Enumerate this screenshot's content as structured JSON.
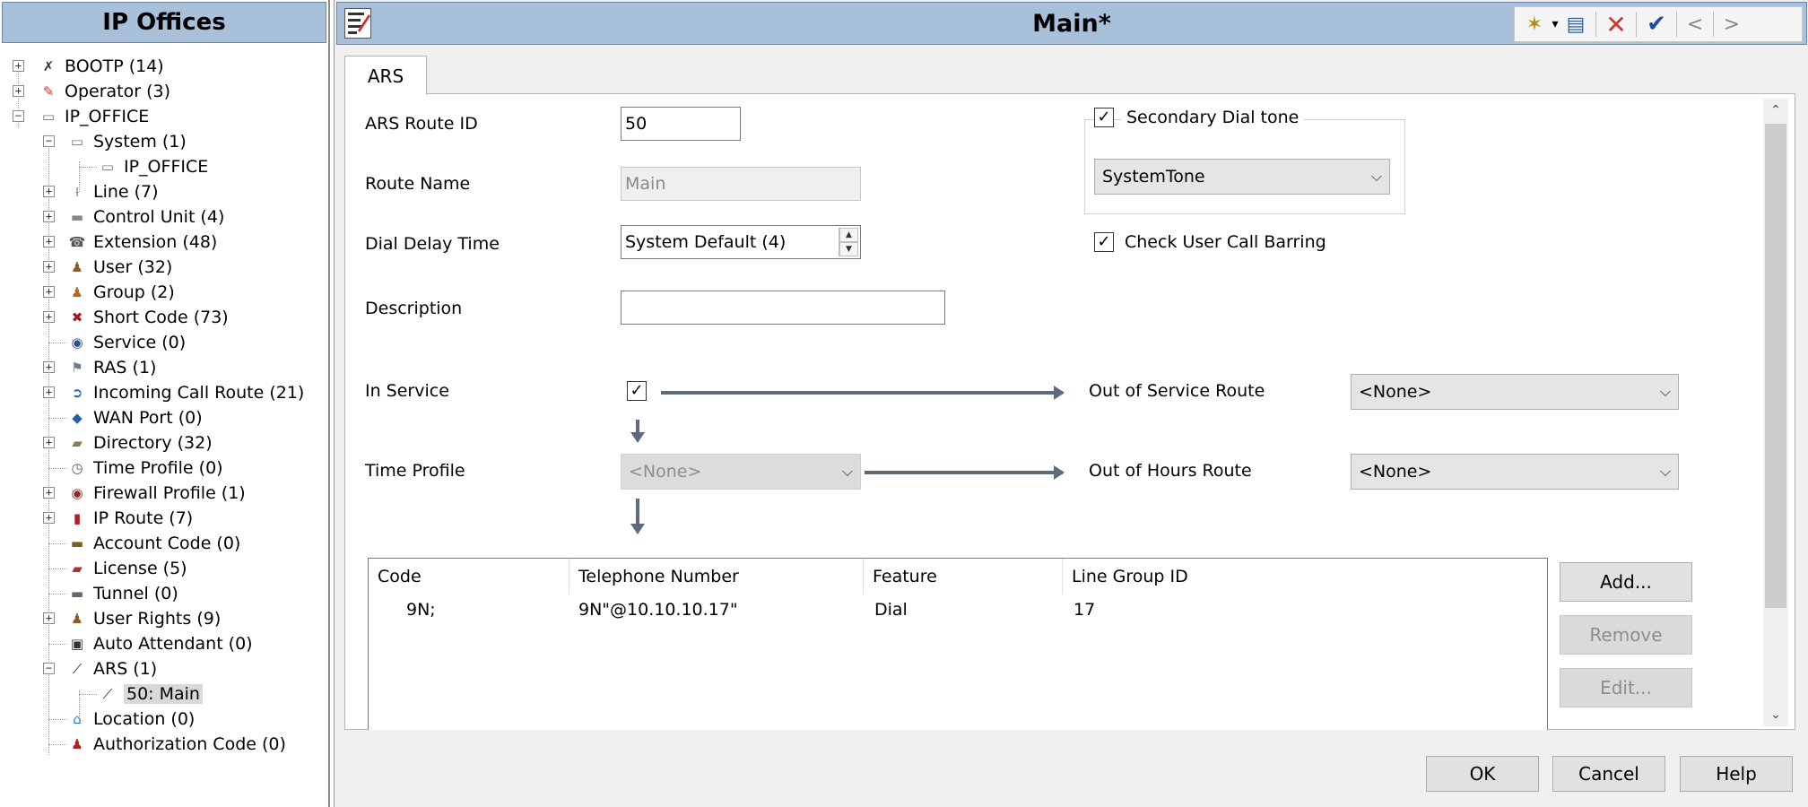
{
  "left_pane": {
    "title": "IP Offices",
    "tree": [
      {
        "label": "BOOTP (14)",
        "icon": "bootp-icon",
        "glyph": "✗",
        "color": "#333333"
      },
      {
        "label": "Operator (3)",
        "icon": "operator-icon",
        "glyph": "✎",
        "color": "#c0392b"
      },
      {
        "label": "IP_OFFICE",
        "icon": "ip-office-unit-icon",
        "glyph": "▭",
        "color": "#777777"
      },
      {
        "label": "System (1)",
        "icon": "system-icon",
        "glyph": "▭",
        "color": "#777777"
      },
      {
        "label": "IP_OFFICE",
        "icon": "system-unit-icon",
        "glyph": "▭",
        "color": "#777777"
      },
      {
        "label": "Line (7)",
        "icon": "line-icon",
        "glyph": "⟊",
        "color": "#444444"
      },
      {
        "label": "Control Unit (4)",
        "icon": "control-unit-icon",
        "glyph": "▬",
        "color": "#888888"
      },
      {
        "label": "Extension (48)",
        "icon": "extension-icon",
        "glyph": "☎",
        "color": "#555555"
      },
      {
        "label": "User (32)",
        "icon": "user-icon",
        "glyph": "♟",
        "color": "#8a5a2b"
      },
      {
        "label": "Group (2)",
        "icon": "group-icon",
        "glyph": "♟",
        "color": "#b06a2b"
      },
      {
        "label": "Short Code (73)",
        "icon": "short-code-icon",
        "glyph": "✖",
        "color": "#a01c1c"
      },
      {
        "label": "Service (0)",
        "icon": "service-icon",
        "glyph": "◉",
        "color": "#2a4d8f"
      },
      {
        "label": "RAS (1)",
        "icon": "ras-icon",
        "glyph": "⚑",
        "color": "#6d7c93"
      },
      {
        "label": "Incoming Call Route (21)",
        "icon": "incoming-call-route-icon",
        "glyph": "➲",
        "color": "#1f5fbf"
      },
      {
        "label": "WAN Port (0)",
        "icon": "wan-port-icon",
        "glyph": "◆",
        "color": "#2a5fa8"
      },
      {
        "label": "Directory (32)",
        "icon": "directory-icon",
        "glyph": "▰",
        "color": "#8a7a55"
      },
      {
        "label": "Time Profile (0)",
        "icon": "time-profile-icon",
        "glyph": "◷",
        "color": "#555555"
      },
      {
        "label": "Firewall Profile (1)",
        "icon": "firewall-profile-icon",
        "glyph": "◉",
        "color": "#8a2b2b"
      },
      {
        "label": "IP Route (7)",
        "icon": "ip-route-icon",
        "glyph": "▮",
        "color": "#b02020"
      },
      {
        "label": "Account Code (0)",
        "icon": "account-code-icon",
        "glyph": "▬",
        "color": "#7a5c1e"
      },
      {
        "label": "License (5)",
        "icon": "license-icon",
        "glyph": "▰",
        "color": "#b03030"
      },
      {
        "label": "Tunnel (0)",
        "icon": "tunnel-icon",
        "glyph": "▬",
        "color": "#666666"
      },
      {
        "label": "User Rights (9)",
        "icon": "user-rights-icon",
        "glyph": "♟",
        "color": "#8a5a2b"
      },
      {
        "label": "Auto Attendant (0)",
        "icon": "auto-attendant-icon",
        "glyph": "▣",
        "color": "#333333"
      },
      {
        "label": "ARS (1)",
        "icon": "ars-icon",
        "glyph": "⟋",
        "color": "#222222"
      },
      {
        "label": "50: Main",
        "icon": "ars-route-icon",
        "glyph": "⟋",
        "color": "#222222"
      },
      {
        "label": "Location (0)",
        "icon": "location-icon",
        "glyph": "⌂",
        "color": "#2a7fbf"
      },
      {
        "label": "Authorization Code (0)",
        "icon": "authorization-code-icon",
        "glyph": "♟",
        "color": "#b02020"
      }
    ]
  },
  "header": {
    "title": "Main*",
    "toolbar": {
      "new": "✶",
      "new_dropdown": "▾",
      "export": "▤",
      "delete": "✕",
      "validate": "✔",
      "previous": "<",
      "next": ">"
    }
  },
  "tabs": [
    {
      "label": "ARS"
    }
  ],
  "form": {
    "route_id_label": "ARS Route ID",
    "route_id_value": "50",
    "route_name_label": "Route Name",
    "route_name_value": "Main",
    "dial_delay_label": "Dial Delay Time",
    "dial_delay_value": "System Default (4)",
    "description_label": "Description",
    "description_value": "",
    "secondary_dial_tone_label": "Secondary Dial tone",
    "secondary_dial_tone_checked": "☑",
    "secondary_dial_tone_value": "SystemTone",
    "check_user_call_barring_label": "Check User Call Barring",
    "check_user_call_barring_checked": "☑",
    "in_service_label": "In Service",
    "in_service_checked": "✓",
    "out_of_service_label": "Out of Service Route",
    "out_of_service_value": "<None>",
    "time_profile_label": "Time Profile",
    "time_profile_value": "<None>",
    "out_of_hours_label": "Out of Hours Route",
    "out_of_hours_value": "<None>"
  },
  "route_table": {
    "columns": [
      "Code",
      "Telephone Number",
      "Feature",
      "Line Group ID"
    ],
    "rows": [
      {
        "code": "9N;",
        "telephone_number": "9N\"@10.10.10.17\"",
        "feature": "Dial",
        "line_group_id": "17"
      }
    ]
  },
  "side_buttons": {
    "add": "Add...",
    "remove": "Remove",
    "edit": "Edit..."
  },
  "bottom_buttons": {
    "ok": "OK",
    "cancel": "Cancel",
    "help": "Help"
  },
  "colors": {
    "header_bg": "#a9c0da",
    "connector": "#5f6b7a",
    "delete_red": "#c0392b",
    "validate_blue": "#1f4e9c"
  }
}
